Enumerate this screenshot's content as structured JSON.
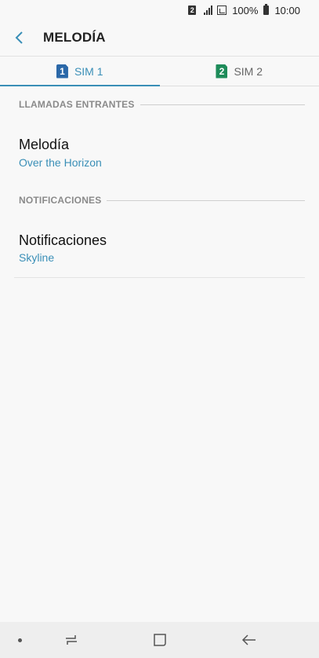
{
  "status_bar": {
    "sim_indicator": "2",
    "battery": "100%",
    "time": "10:00"
  },
  "header": {
    "title": "MELODÍA",
    "back_icon": "chevron-left-icon"
  },
  "tabs": [
    {
      "badge": "1",
      "label": "SIM 1",
      "active": true,
      "color": "#2b68a8"
    },
    {
      "badge": "2",
      "label": "SIM 2",
      "active": false,
      "color": "#1e8c5a"
    }
  ],
  "sections": [
    {
      "header": "LLAMADAS ENTRANTES",
      "items": [
        {
          "title": "Melodía",
          "subtitle": "Over the Horizon"
        }
      ]
    },
    {
      "header": "NOTIFICACIONES",
      "items": [
        {
          "title": "Notificaciones",
          "subtitle": "Skyline"
        }
      ]
    }
  ],
  "colors": {
    "accent": "#3a8fb7",
    "background": "#f8f8f8",
    "navbar": "#eeeeee"
  },
  "navbar": {
    "icons": [
      "dot-icon",
      "recent-apps-icon",
      "home-icon",
      "back-arrow-icon"
    ]
  }
}
